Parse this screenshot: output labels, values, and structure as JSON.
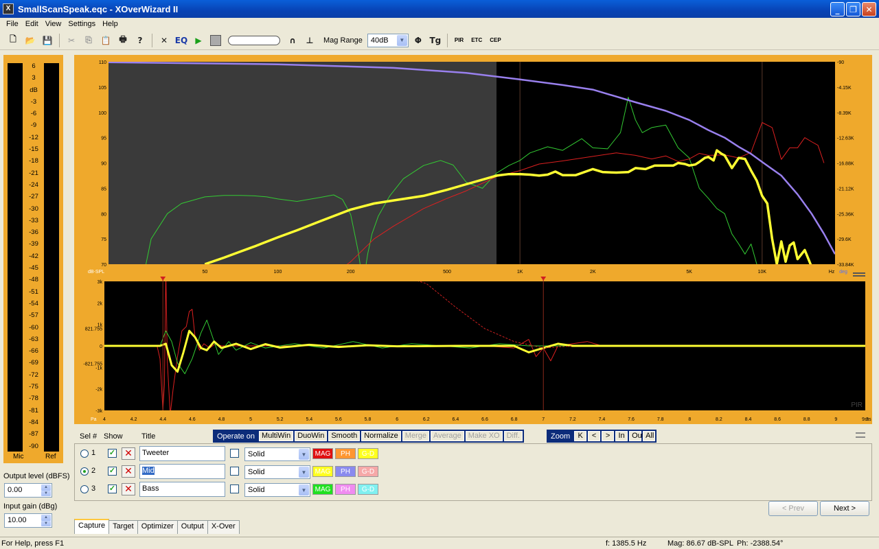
{
  "window": {
    "title": "SmallScanSpeak.eqc - XOverWizard II",
    "app_icon": "X"
  },
  "menu": [
    "File",
    "Edit",
    "View",
    "Settings",
    "Help"
  ],
  "toolbar": {
    "mag_range_label": "Mag Range",
    "mag_range_value": "40dB",
    "eq_label": "EQ",
    "pir_label": "PIR",
    "etc_label": "ETC",
    "cep_label": "CEP",
    "phi_label": "Φ",
    "tg_label": "Tg"
  },
  "meter": {
    "scale": [
      "6",
      "3",
      "dB",
      "-3",
      "-6",
      "-9",
      "-12",
      "-15",
      "-18",
      "-21",
      "-24",
      "-27",
      "-30",
      "-33",
      "-36",
      "-39",
      "-42",
      "-45",
      "-48",
      "-51",
      "-54",
      "-57",
      "-60",
      "-63",
      "-66",
      "-69",
      "-72",
      "-75",
      "-78",
      "-81",
      "-84",
      "-87",
      "-90"
    ],
    "left_label": "Mic",
    "right_label": "Ref"
  },
  "output_level": {
    "label": "Output level (dBFS)",
    "value": "0.00"
  },
  "input_gain": {
    "label": "Input gain (dBg)",
    "value": "10.00"
  },
  "chart_data": [
    {
      "type": "line",
      "title": "",
      "xscale": "log",
      "xlim": [
        20,
        20000
      ],
      "ylim": [
        70,
        110
      ],
      "y_ticks": [
        "110",
        "105",
        "100",
        "95",
        "90",
        "85",
        "80",
        "75",
        "70"
      ],
      "x_ticks": [
        "50",
        "100",
        "200",
        "500",
        "1K",
        "2K",
        "5K",
        "10K"
      ],
      "x_tick_values": [
        50,
        100,
        200,
        500,
        1000,
        2000,
        5000,
        10000
      ],
      "xunit": "Hz",
      "yunit": "dB-SPL",
      "y2unit": "deg",
      "y2_ticks": [
        "-90",
        "-4.15K",
        "-8.39K",
        "-12.63K",
        "-16.88K",
        "-21.12K",
        "-25.36K",
        "-29.6K",
        "-33.84K"
      ],
      "shaded_region": [
        20,
        800
      ],
      "series": [
        {
          "color": "#33cc33",
          "x": [
            28,
            30,
            35,
            40,
            50,
            60,
            70,
            80,
            90,
            100,
            120,
            150,
            170,
            185,
            200,
            215,
            225,
            235,
            245,
            260,
            290,
            330,
            400,
            470,
            530,
            600,
            700,
            800,
            900,
            1000,
            1100,
            1300,
            1500,
            1800,
            2000,
            2300,
            2600,
            2800,
            3000,
            3200,
            3500,
            4000,
            4500,
            5000,
            5500,
            6000,
            6500,
            7000,
            7500,
            8000,
            8500,
            9000,
            9500,
            10000
          ],
          "y": [
            68,
            75,
            80,
            82,
            83.3,
            83.6,
            83.6,
            83.5,
            83.3,
            82.9,
            82.4,
            83.2,
            83.7,
            82.8,
            79.8,
            72.5,
            66,
            72,
            76,
            79.5,
            83.5,
            86.9,
            89.5,
            90.5,
            89.6,
            86.2,
            85,
            88,
            89.5,
            90.5,
            92,
            93.2,
            92.5,
            94.8,
            93,
            92.8,
            96,
            103,
            98.5,
            96,
            97,
            97.5,
            93,
            91,
            85,
            83,
            81,
            80,
            76,
            74,
            72,
            74,
            70,
            68
          ]
        },
        {
          "color": "#dd2020",
          "x": [
            150,
            200,
            250,
            300,
            400,
            500,
            600,
            700,
            800,
            1000,
            1200,
            1500,
            2000,
            2500,
            3000,
            3500,
            4000,
            4500,
            5000,
            5500,
            6000,
            7000,
            8000,
            9000,
            10000,
            11000,
            12000,
            13000,
            14000,
            15000,
            16000,
            17000,
            18000
          ],
          "y": [
            66,
            70.5,
            75,
            77.5,
            81,
            83,
            84.5,
            86,
            87.3,
            88.5,
            89.8,
            90.4,
            91.3,
            92,
            91.5,
            90.8,
            91.4,
            90.3,
            90.8,
            91.9,
            91.5,
            91.6,
            91,
            92.1,
            98,
            97,
            90.7,
            93,
            93,
            95,
            94.2,
            93.5,
            90
          ]
        },
        {
          "color": "#ffff33",
          "x": [
            50,
            60,
            70,
            80,
            100,
            120,
            150,
            200,
            250,
            300,
            400,
            500,
            600,
            700,
            800,
            900,
            1000,
            1100,
            1200,
            1300,
            1400,
            1500,
            1700,
            2000,
            2200,
            2500,
            2800,
            3000,
            3300,
            3600,
            4000,
            4300,
            4500,
            4800,
            5000,
            5300,
            5500,
            5800,
            6000,
            6300,
            6500,
            6800,
            7000,
            7500,
            8000,
            8500,
            9000,
            9500,
            10000,
            10500,
            11000,
            11500,
            12000,
            12500,
            13000,
            13500,
            14000,
            15000,
            16000
          ],
          "y": [
            70,
            71.3,
            72.5,
            73.5,
            75.3,
            76.7,
            78.5,
            80.8,
            82,
            82.6,
            83.5,
            84.7,
            85.8,
            86.7,
            87.5,
            87.8,
            87.8,
            87.7,
            87.5,
            87.7,
            88.3,
            87.6,
            87.6,
            88.8,
            88.2,
            88.1,
            88.2,
            89,
            88.8,
            89.5,
            89.5,
            89.5,
            90,
            89.8,
            89.5,
            89.7,
            90.2,
            91,
            91.2,
            90.5,
            92.5,
            91.8,
            91.5,
            89,
            91,
            90.8,
            88.5,
            86.5,
            83.5,
            82,
            75,
            70,
            74.5,
            70.5,
            73.7,
            74.3,
            71,
            72.8,
            69.5
          ]
        },
        {
          "color": "#9980ee",
          "x": [
            20,
            100,
            300,
            600,
            1000,
            1500,
            2000,
            3000,
            4000,
            5000,
            6000,
            7000,
            8000,
            9000,
            10000,
            12000,
            14000,
            16000,
            18000,
            20000
          ],
          "y": [
            109.9,
            109.5,
            108.8,
            107.8,
            106.5,
            105.4,
            104.5,
            102,
            100.3,
            98.5,
            96.5,
            95,
            93.2,
            91.8,
            90.2,
            87.5,
            83.8,
            80,
            76,
            72
          ]
        }
      ]
    },
    {
      "type": "line",
      "title": "",
      "xlim": [
        4,
        9.2
      ],
      "ylim": [
        -3000,
        3000
      ],
      "y_ticks": [
        "3k",
        "2k",
        "1k",
        "821.755",
        "0",
        "-821.755",
        "-1k",
        "-2k",
        "-3k"
      ],
      "y_tick_values": [
        3000,
        2000,
        1000,
        821.755,
        0,
        -821.755,
        -1000,
        -2000,
        -3000
      ],
      "x_ticks": [
        "4",
        "4.2",
        "4.4",
        "4.6",
        "4.8",
        "5",
        "5.2",
        "5.4",
        "5.6",
        "5.8",
        "6",
        "6.2",
        "6.4",
        "6.6",
        "6.8",
        "7",
        "7.2",
        "7.4",
        "7.6",
        "7.8",
        "8",
        "8.2",
        "8.4",
        "8.6",
        "8.8",
        "9",
        "9.2"
      ],
      "xunit": "ms",
      "yunit": "Pa",
      "markers": [
        4.4,
        7.0
      ],
      "corner_label": "PIR",
      "series": [
        {
          "color": "#dd2020",
          "x": [
            4.0,
            4.36,
            4.38,
            4.4,
            4.41,
            4.42,
            4.43,
            4.45,
            4.47,
            4.5,
            4.53,
            4.56,
            4.58,
            4.6,
            4.62,
            4.65,
            4.68,
            4.72,
            4.76,
            4.8,
            4.9,
            5.0,
            5.2,
            6.6,
            6.8,
            6.9,
            6.95,
            7.0,
            7.05,
            7.1,
            7.2,
            7.3,
            7.4,
            7.6,
            9.2
          ],
          "y": [
            0,
            0,
            -600,
            -3000,
            -1800,
            3500,
            -700,
            -3200,
            -2000,
            -500,
            700,
            900,
            1600,
            1700,
            400,
            -200,
            100,
            -100,
            100,
            0,
            0,
            0,
            0,
            0,
            -100,
            300,
            -500,
            -100,
            -700,
            0,
            100,
            200,
            0,
            0,
            0
          ]
        },
        {
          "color": "#33cc33",
          "x": [
            4.0,
            4.38,
            4.42,
            4.46,
            4.5,
            4.55,
            4.6,
            4.66,
            4.7,
            4.74,
            4.78,
            4.85,
            4.9,
            5.0,
            5.1,
            5.3,
            5.5,
            5.7,
            5.9,
            6.1,
            6.3,
            6.5,
            6.7,
            6.9,
            7.1,
            7.3,
            9.2
          ],
          "y": [
            0,
            0,
            700,
            200,
            -800,
            -1300,
            -600,
            600,
            1200,
            400,
            -400,
            200,
            -200,
            150,
            -100,
            100,
            -100,
            200,
            -100,
            100,
            0,
            -100,
            100,
            0,
            0,
            0,
            0
          ]
        },
        {
          "color": "#ffff33",
          "x": [
            4.0,
            4.38,
            4.42,
            4.46,
            4.5,
            4.54,
            4.58,
            4.62,
            4.66,
            4.7,
            4.75,
            4.8,
            4.9,
            5.0,
            5.1,
            5.2,
            5.4,
            5.6,
            5.8,
            6.0,
            6.4,
            6.8,
            6.9,
            7.0,
            7.1,
            7.2,
            7.4,
            7.6,
            9.2
          ],
          "y": [
            0,
            0,
            100,
            -900,
            -1200,
            -300,
            700,
            400,
            -100,
            -200,
            200,
            -100,
            100,
            -150,
            80,
            -80,
            50,
            -50,
            30,
            -20,
            0,
            0,
            -300,
            -100,
            100,
            0,
            0,
            0,
            0
          ]
        },
        {
          "color": "#cc2020",
          "dashed": true,
          "x": [
            5.75,
            6.0,
            6.2,
            6.4,
            6.6,
            6.8,
            7.0,
            7.2
          ],
          "y": [
            3700,
            3300,
            2900,
            1800,
            800,
            200,
            -100,
            0
          ]
        }
      ]
    }
  ],
  "operate": {
    "label": "Operate on",
    "buttons": [
      "MultiWin",
      "DuoWin",
      "Smooth",
      "Normalize"
    ],
    "disabled_buttons": [
      "Merge",
      "Average",
      "Make XO",
      "Diff."
    ]
  },
  "zoom": {
    "label": "Zoom",
    "buttons": [
      "K",
      "<",
      ">",
      "In",
      "Out",
      "All"
    ]
  },
  "list_headers": {
    "sel": "Sel #",
    "show": "Show",
    "title": "Title"
  },
  "rows": [
    {
      "num": "1",
      "title": "Tweeter",
      "line": "Solid",
      "selected": false,
      "swatches": [
        {
          "label": "MAG",
          "bg": "#e01010",
          "fg": "#ffffff"
        },
        {
          "label": "PH",
          "bg": "#ff9630",
          "fg": "#ffffff"
        },
        {
          "label": "G-D",
          "bg": "#ffff20",
          "fg": "#ffffff"
        }
      ]
    },
    {
      "num": "2",
      "title": "Mid",
      "line": "Solid",
      "selected": true,
      "swatches": [
        {
          "label": "MAG",
          "bg": "#ffff20",
          "fg": "#ffffff"
        },
        {
          "label": "PH",
          "bg": "#8a8aee",
          "fg": "#ffffff"
        },
        {
          "label": "G-D",
          "bg": "#f6a8a8",
          "fg": "#ffffff"
        }
      ]
    },
    {
      "num": "3",
      "title": "Bass",
      "line": "Solid",
      "selected": false,
      "swatches": [
        {
          "label": "MAG",
          "bg": "#20e020",
          "fg": "#ffffff"
        },
        {
          "label": "PH",
          "bg": "#f08cf0",
          "fg": "#ffffff"
        },
        {
          "label": "G-D",
          "bg": "#80f0f0",
          "fg": "#ffffff"
        }
      ]
    }
  ],
  "nav": {
    "prev": "< Prev",
    "next": "Next >"
  },
  "tabs": [
    "Capture",
    "Target",
    "Optimizer",
    "Output",
    "X-Over"
  ],
  "status": {
    "help": "For Help, press F1",
    "freq": "f:  1385.5 Hz",
    "mag": "Mag: 86.67 dB-SPL",
    "phase": "Ph: -2388.54°"
  }
}
